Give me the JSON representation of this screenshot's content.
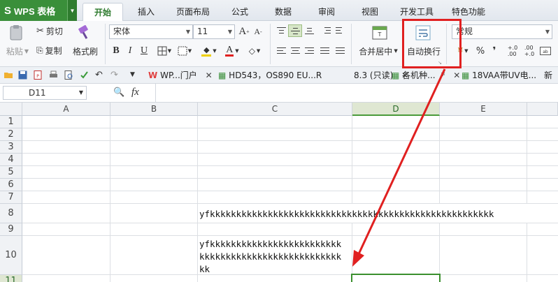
{
  "app": {
    "name": "WPS 表格",
    "logo": "S"
  },
  "tabs": [
    "开始",
    "插入",
    "页面布局",
    "公式",
    "数据",
    "审阅",
    "视图",
    "开发工具",
    "特色功能"
  ],
  "active_tab": "开始",
  "ribbon": {
    "paste": "粘贴",
    "cut": "剪切",
    "copy": "复制",
    "format_painter": "格式刷",
    "font_name": "宋体",
    "font_size": "11",
    "bold": "B",
    "italic": "I",
    "underline": "U",
    "font_color_letter": "A",
    "merge_center": "合并居中",
    "wrap_text": "自动换行",
    "number_format": "常规",
    "percent": "%",
    "comma": "❜",
    "increase_decimal": "+.0\n.00",
    "decrease_decimal": ".00\n+.0"
  },
  "doc_tabs": [
    {
      "label": "WP...门户"
    },
    {
      "label": "HD543，OS890 EU...R"
    },
    {
      "label": "8.3 (只读)"
    },
    {
      "label": "各机种..."
    },
    {
      "label": "18VAA带UV电..."
    },
    {
      "label": "新"
    }
  ],
  "formula_bar": {
    "name_box": "D11",
    "fx": "fx"
  },
  "columns": [
    "A",
    "B",
    "C",
    "D",
    "E"
  ],
  "rows": [
    "1",
    "2",
    "3",
    "4",
    "5",
    "6",
    "7",
    "8",
    "9",
    "10",
    "11"
  ],
  "selected_cell": "D11",
  "cells": {
    "C8": "yfkkkkkkkkkkkkkkkkkkkkkkkkkkkkkkkkkkkkkkkkkkkkkkkkkkkkkk",
    "C10_line1": "yfkkkkkkkkkkkkkkkkkkkkkkkkk",
    "C10_line2": "kkkkkkkkkkkkkkkkkkkkkkkkkkk",
    "C10_line3": "kk"
  },
  "colors": {
    "app_green": "#3a8f3a",
    "annotation_red": "#e02020",
    "selection_green": "#3b8f2e"
  }
}
